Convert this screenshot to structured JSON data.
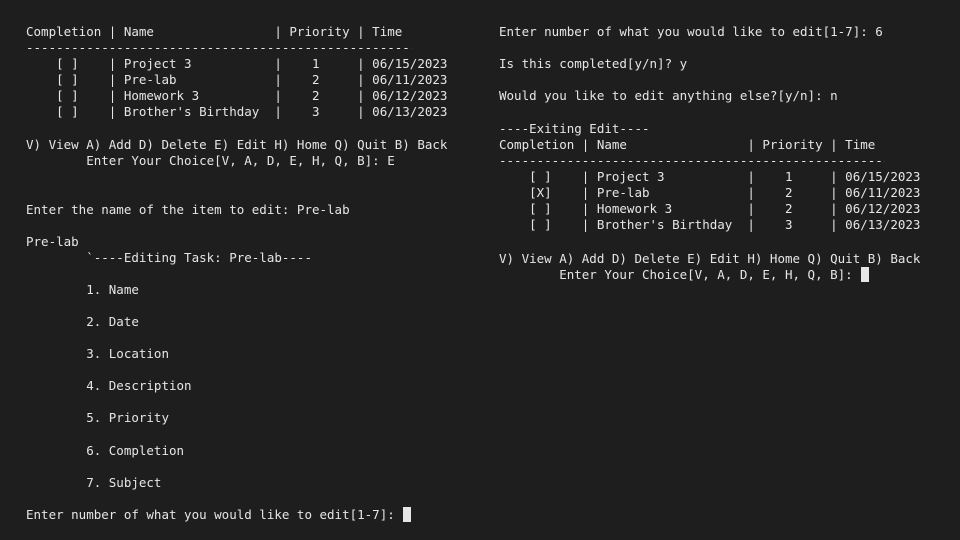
{
  "left_terminal": {
    "lines": [
      "Completion | Name                | Priority | Time",
      "-------------------------------------------------------",
      "    [ ]    | Project 3           |    1     | 06/15/2023",
      "    [ ]    | Pre-lab             |    2     | 06/11/2023",
      "    [ ]    | Homework 3          |    2     | 06/12/2023",
      "    [ ]    | Brother's Birthday  |    3     | 06/13/2023",
      "V) View A) Add D) Delete E) Edit H) Home Q) Quit B) Back",
      "        Enter Your Choice[V, A, D, E, H, Q, B]: E",
      "Enter the name of the item to edit: Pre-lab",
      "Pre-lab",
      "        `----Editing Task: Pre-lab----",
      "        1. Name",
      "        2. Date",
      "        3. Location",
      "        4. Description",
      "        5. Priority",
      "        6. Completion",
      "        7. Subject",
      "Enter number of what you would like to edit[1-7]: "
    ]
  },
  "right_terminal": {
    "lines": [
      "Enter number of what you would like to edit[1-7]: 6",
      "Is this completed[y/n]? y",
      "Would you like to edit anything else?[y/n]: n",
      "----Exiting Edit----",
      "Completion | Name                | Priority | Time",
      "-------------------------------------------------------",
      "    [ ]    | Project 3           |    1     | 06/15/2023",
      "    [X]    | Pre-lab             |    2     | 06/11/2023",
      "    [ ]    | Homework 3          |    2     | 06/12/2023",
      "    [ ]    | Brother's Birthday  |    3     | 06/13/2023",
      "V) View A) Add D) Delete E) Edit H) Home Q) Quit B) Back",
      "        Enter Your Choice[V, A, D, E, H, Q, B]: "
    ]
  },
  "colors": {
    "background": "#1e1e1e",
    "text": "#e6e6e6"
  }
}
